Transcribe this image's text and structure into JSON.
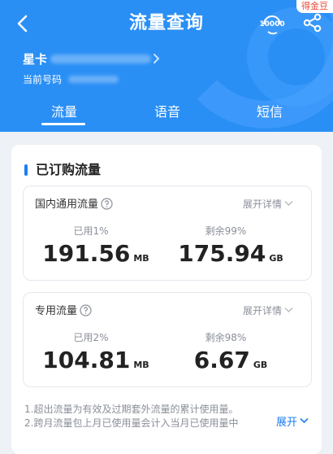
{
  "header": {
    "title": "流量查询",
    "badge": "得金豆",
    "service_icon_text": "10000",
    "account_prefix": "星卡",
    "phone_label": "当前号码",
    "background_color": "#2a8ff5",
    "icons": [
      "back-arrow-icon",
      "customer-service-10000-icon",
      "share-icon",
      "chevron-right-icon"
    ]
  },
  "tabs": [
    {
      "label": "流量",
      "active": true
    },
    {
      "label": "语音",
      "active": false
    },
    {
      "label": "短信",
      "active": false
    }
  ],
  "section": {
    "title": "已订购流量",
    "accent_color": "#1d7ef1"
  },
  "cards": [
    {
      "name": "国内通用流量",
      "expand_label": "展开详情",
      "used_label": "已用1%",
      "used_value": "191.56",
      "used_unit": "MB",
      "remain_label": "剩余99%",
      "remain_value": "175.94",
      "remain_unit": "GB"
    },
    {
      "name": "专用流量",
      "expand_label": "展开详情",
      "used_label": "已用2%",
      "used_value": "104.81",
      "used_unit": "MB",
      "remain_label": "剩余98%",
      "remain_value": "6.67",
      "remain_unit": "GB"
    }
  ],
  "notes": {
    "line1": "1.超出流量为有效及过期套外流量的累计使用量。",
    "line2": "2.跨月流量包上月已使用量会计入当月已使用量中",
    "expand_label": "展开"
  }
}
